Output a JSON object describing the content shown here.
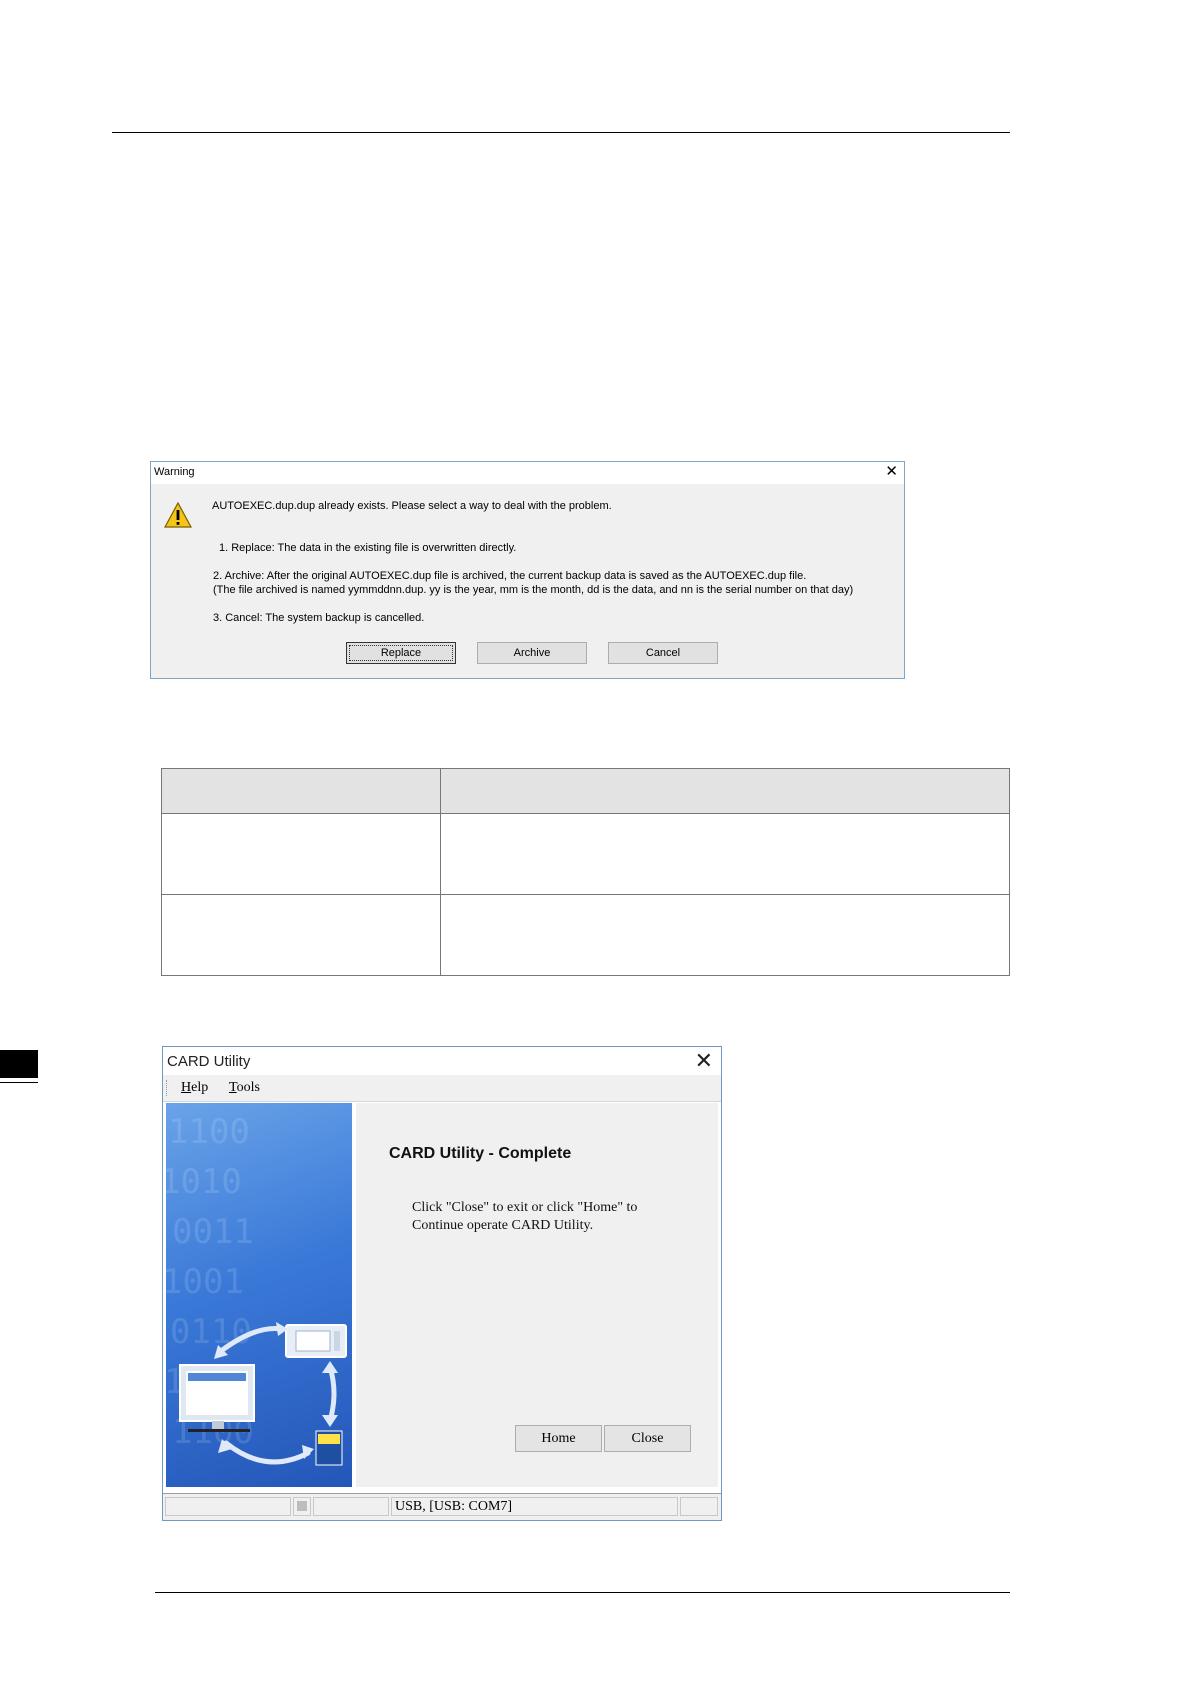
{
  "warning_dialog": {
    "title": "Warning",
    "message": "AUTOEXEC.dup.dup already exists. Please select a way to deal with the problem.",
    "option_replace": "1. Replace: The data in the existing file is overwritten directly.",
    "option_archive": "2. Archive: After the original AUTOEXEC.dup file is archived, the current backup data is saved as the AUTOEXEC.dup file.",
    "option_archive_note": "(The file archived is named yymmddnn.dup. yy is the year, mm is the month, dd is the data, and nn is the serial number on that day)",
    "option_cancel": "3. Cancel: The system backup is cancelled.",
    "buttons": {
      "replace": "Replace",
      "archive": "Archive",
      "cancel": "Cancel"
    },
    "colors": {
      "icon_fill": "#f5c518"
    },
    "icons": {
      "warning": "warning-triangle-icon",
      "close": "close-icon"
    }
  },
  "card_utility": {
    "title": "CARD Utility",
    "menu": {
      "help_mnemonic": "H",
      "help_rest": "elp",
      "tools_mnemonic": "T",
      "tools_rest": "ools"
    },
    "heading": "CARD Utility - Complete",
    "message_line1": "Click \"Close\" to exit or click \"Home\" to",
    "message_line2": "Continue operate CARD Utility.",
    "buttons": {
      "home": "Home",
      "close": "Close"
    },
    "status": {
      "connection": "USB, [USB: COM7]"
    }
  }
}
